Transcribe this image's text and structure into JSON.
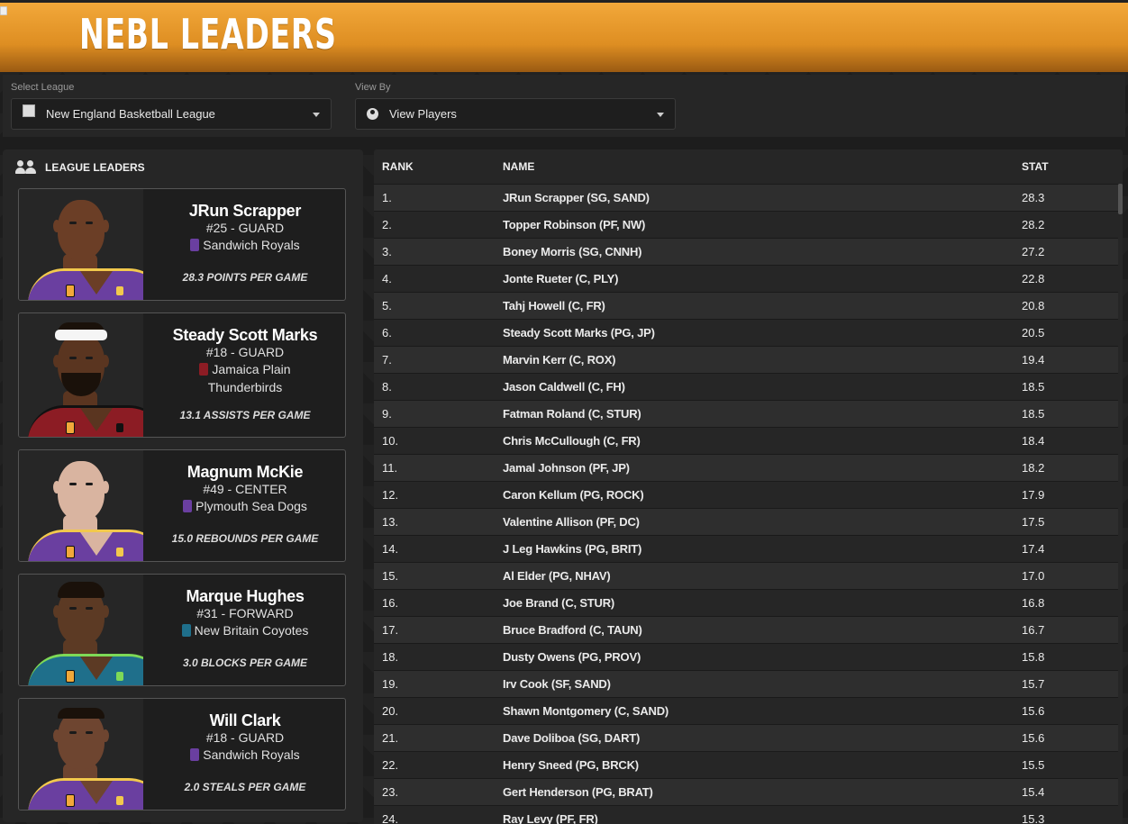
{
  "header": {
    "title": "NEBL LEADERS"
  },
  "filters": {
    "league": {
      "label": "Select League",
      "value": "New England Basketball League"
    },
    "view": {
      "label": "View By",
      "value": "View Players"
    }
  },
  "leaders": {
    "title": "LEAGUE LEADERS",
    "cards": [
      {
        "name": "JRun Scrapper",
        "number_position": "#25 - GUARD",
        "team_line1": "Sandwich Royals",
        "team_line2": "",
        "stat": "28.3 POINTS PER GAME",
        "jersey_color": "#6a3fa0",
        "trim_color": "#f2c94c",
        "skin": "#6b3e26"
      },
      {
        "name": "Steady Scott Marks",
        "number_position": "#18 - GUARD",
        "team_line1": "Jamaica Plain",
        "team_line2": "Thunderbirds",
        "stat": "13.1 ASSISTS PER GAME",
        "jersey_color": "#8c1c24",
        "trim_color": "#111111",
        "skin": "#5a3520"
      },
      {
        "name": "Magnum McKie",
        "number_position": "#49 - CENTER",
        "team_line1": "Plymouth Sea Dogs",
        "team_line2": "",
        "stat": "15.0 REBOUNDS PER GAME",
        "jersey_color": "#6a3fa0",
        "trim_color": "#f2c94c",
        "skin": "#d9b4a0"
      },
      {
        "name": "Marque Hughes",
        "number_position": "#31 - FORWARD",
        "team_line1": "New Britain Coyotes",
        "team_line2": "",
        "stat": "3.0 BLOCKS PER GAME",
        "jersey_color": "#1f6f8b",
        "trim_color": "#7ed957",
        "skin": "#5c3a24"
      },
      {
        "name": "Will Clark",
        "number_position": "#18 - GUARD",
        "team_line1": "Sandwich Royals",
        "team_line2": "",
        "stat": "2.0 STEALS PER GAME",
        "jersey_color": "#6a3fa0",
        "trim_color": "#f2c94c",
        "skin": "#6e4530"
      }
    ]
  },
  "table": {
    "headers": {
      "rank": "RANK",
      "name": "NAME",
      "stat": "STAT"
    },
    "rows": [
      {
        "rank": "1.",
        "name": "JRun Scrapper (SG, SAND)",
        "stat": "28.3"
      },
      {
        "rank": "2.",
        "name": "Topper Robinson (PF, NW)",
        "stat": "28.2"
      },
      {
        "rank": "3.",
        "name": "Boney Morris (SG, CNNH)",
        "stat": "27.2"
      },
      {
        "rank": "4.",
        "name": "Jonte Rueter (C, PLY)",
        "stat": "22.8"
      },
      {
        "rank": "5.",
        "name": "Tahj Howell (C, FR)",
        "stat": "20.8"
      },
      {
        "rank": "6.",
        "name": "Steady Scott Marks (PG, JP)",
        "stat": "20.5"
      },
      {
        "rank": "7.",
        "name": "Marvin Kerr (C, ROX)",
        "stat": "19.4"
      },
      {
        "rank": "8.",
        "name": "Jason Caldwell (C, FH)",
        "stat": "18.5"
      },
      {
        "rank": "9.",
        "name": "Fatman Roland (C, STUR)",
        "stat": "18.5"
      },
      {
        "rank": "10.",
        "name": "Chris McCullough (C, FR)",
        "stat": "18.4"
      },
      {
        "rank": "11.",
        "name": "Jamal Johnson (PF, JP)",
        "stat": "18.2"
      },
      {
        "rank": "12.",
        "name": "Caron Kellum (PG, ROCK)",
        "stat": "17.9"
      },
      {
        "rank": "13.",
        "name": "Valentine Allison (PF, DC)",
        "stat": "17.5"
      },
      {
        "rank": "14.",
        "name": "J Leg Hawkins (PG, BRIT)",
        "stat": "17.4"
      },
      {
        "rank": "15.",
        "name": "Al Elder (PG, NHAV)",
        "stat": "17.0"
      },
      {
        "rank": "16.",
        "name": "Joe Brand (C, STUR)",
        "stat": "16.8"
      },
      {
        "rank": "17.",
        "name": "Bruce Bradford (C, TAUN)",
        "stat": "16.7"
      },
      {
        "rank": "18.",
        "name": "Dusty Owens (PG, PROV)",
        "stat": "15.8"
      },
      {
        "rank": "19.",
        "name": "Irv Cook (SF, SAND)",
        "stat": "15.7"
      },
      {
        "rank": "20.",
        "name": "Shawn Montgomery (C, SAND)",
        "stat": "15.6"
      },
      {
        "rank": "21.",
        "name": "Dave Doliboa (SG, DART)",
        "stat": "15.6"
      },
      {
        "rank": "22.",
        "name": "Henry Sneed (PG, BRCK)",
        "stat": "15.5"
      },
      {
        "rank": "23.",
        "name": "Gert Henderson (PG, BRAT)",
        "stat": "15.4"
      },
      {
        "rank": "24.",
        "name": "Ray Levy (PF, FR)",
        "stat": "15.3"
      }
    ]
  }
}
